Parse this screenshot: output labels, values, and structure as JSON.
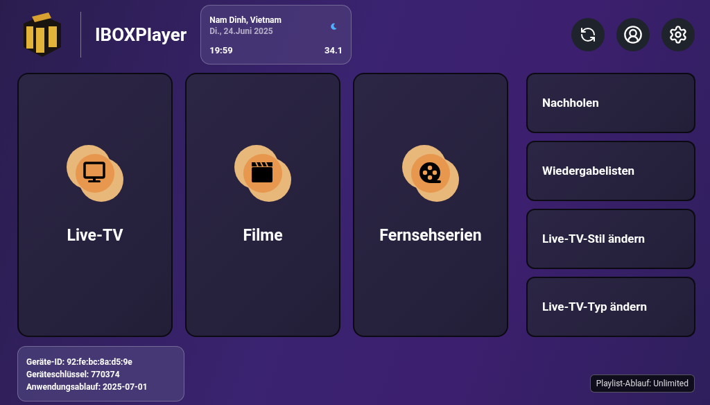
{
  "header": {
    "app_name": "IBOXPlayer",
    "weather": {
      "location": "Nam Dinh, Vietnam",
      "date": "Di., 24.Juni 2025",
      "time": "19:59",
      "temperature": "34.1"
    },
    "actions": [
      {
        "kind": "refresh"
      },
      {
        "kind": "profile"
      },
      {
        "kind": "settings"
      }
    ]
  },
  "tiles": [
    {
      "kind": "tv",
      "label": "Live-TV"
    },
    {
      "kind": "movie",
      "label": "Filme"
    },
    {
      "kind": "series",
      "label": "Fernsehserien"
    }
  ],
  "menu": [
    {
      "label": "Nachholen"
    },
    {
      "label": "Wiedergabelisten"
    },
    {
      "label": "Live-TV-Stil ändern"
    },
    {
      "label": "Live-TV-Typ ändern"
    }
  ],
  "device_info": [
    "Geräte-ID: 92:fe:bc:8a:d5:9e",
    "Geräteschlüssel: 770374",
    "Anwendungsablauf: 2025-07-01"
  ],
  "playlist_expiry": "Playlist-Ablauf: Unlimited"
}
